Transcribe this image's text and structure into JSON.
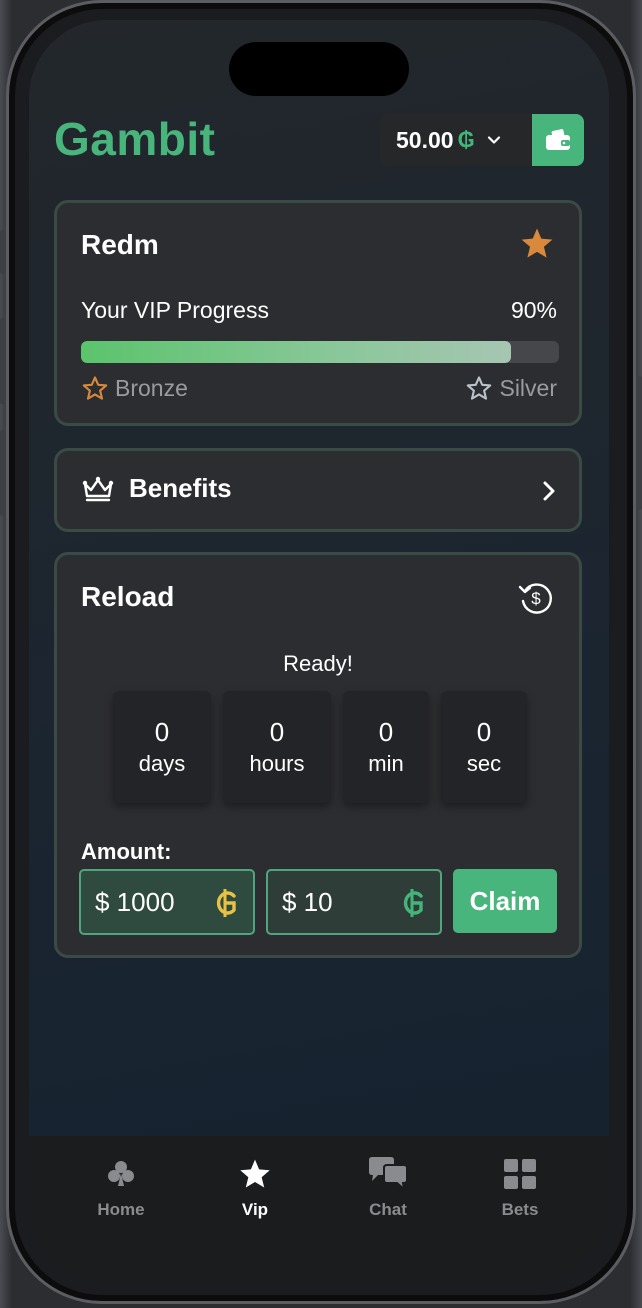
{
  "app": {
    "name": "Gambit"
  },
  "header": {
    "balance": "50.00",
    "currency_symbol": "₲"
  },
  "vip": {
    "username": "Redm",
    "progress_label": "Your VIP Progress",
    "progress_percent_text": "90%",
    "progress_fraction": 0.9,
    "current_tier": "Bronze",
    "next_tier": "Silver"
  },
  "benefits": {
    "label": "Benefits"
  },
  "reload": {
    "title": "Reload",
    "status": "Ready!",
    "timer": [
      {
        "value": "0",
        "unit": "days"
      },
      {
        "value": "0",
        "unit": "hours"
      },
      {
        "value": "0",
        "unit": "min"
      },
      {
        "value": "0",
        "unit": "sec"
      }
    ],
    "amount_label": "Amount:",
    "amount_primary": "$ 1000",
    "amount_secondary": "$ 10",
    "claim_label": "Claim"
  },
  "nav": {
    "items": [
      {
        "label": "Home",
        "icon": "club-icon"
      },
      {
        "label": "Vip",
        "icon": "star-icon"
      },
      {
        "label": "Chat",
        "icon": "chat-bubbles-icon"
      },
      {
        "label": "Bets",
        "icon": "grid-icon"
      }
    ],
    "active": "Vip"
  },
  "colors": {
    "brand_green": "#48b57c",
    "gold_coin": "#e8c244",
    "bronze_star": "#d8893c",
    "card_bg": "#2c2d30"
  }
}
